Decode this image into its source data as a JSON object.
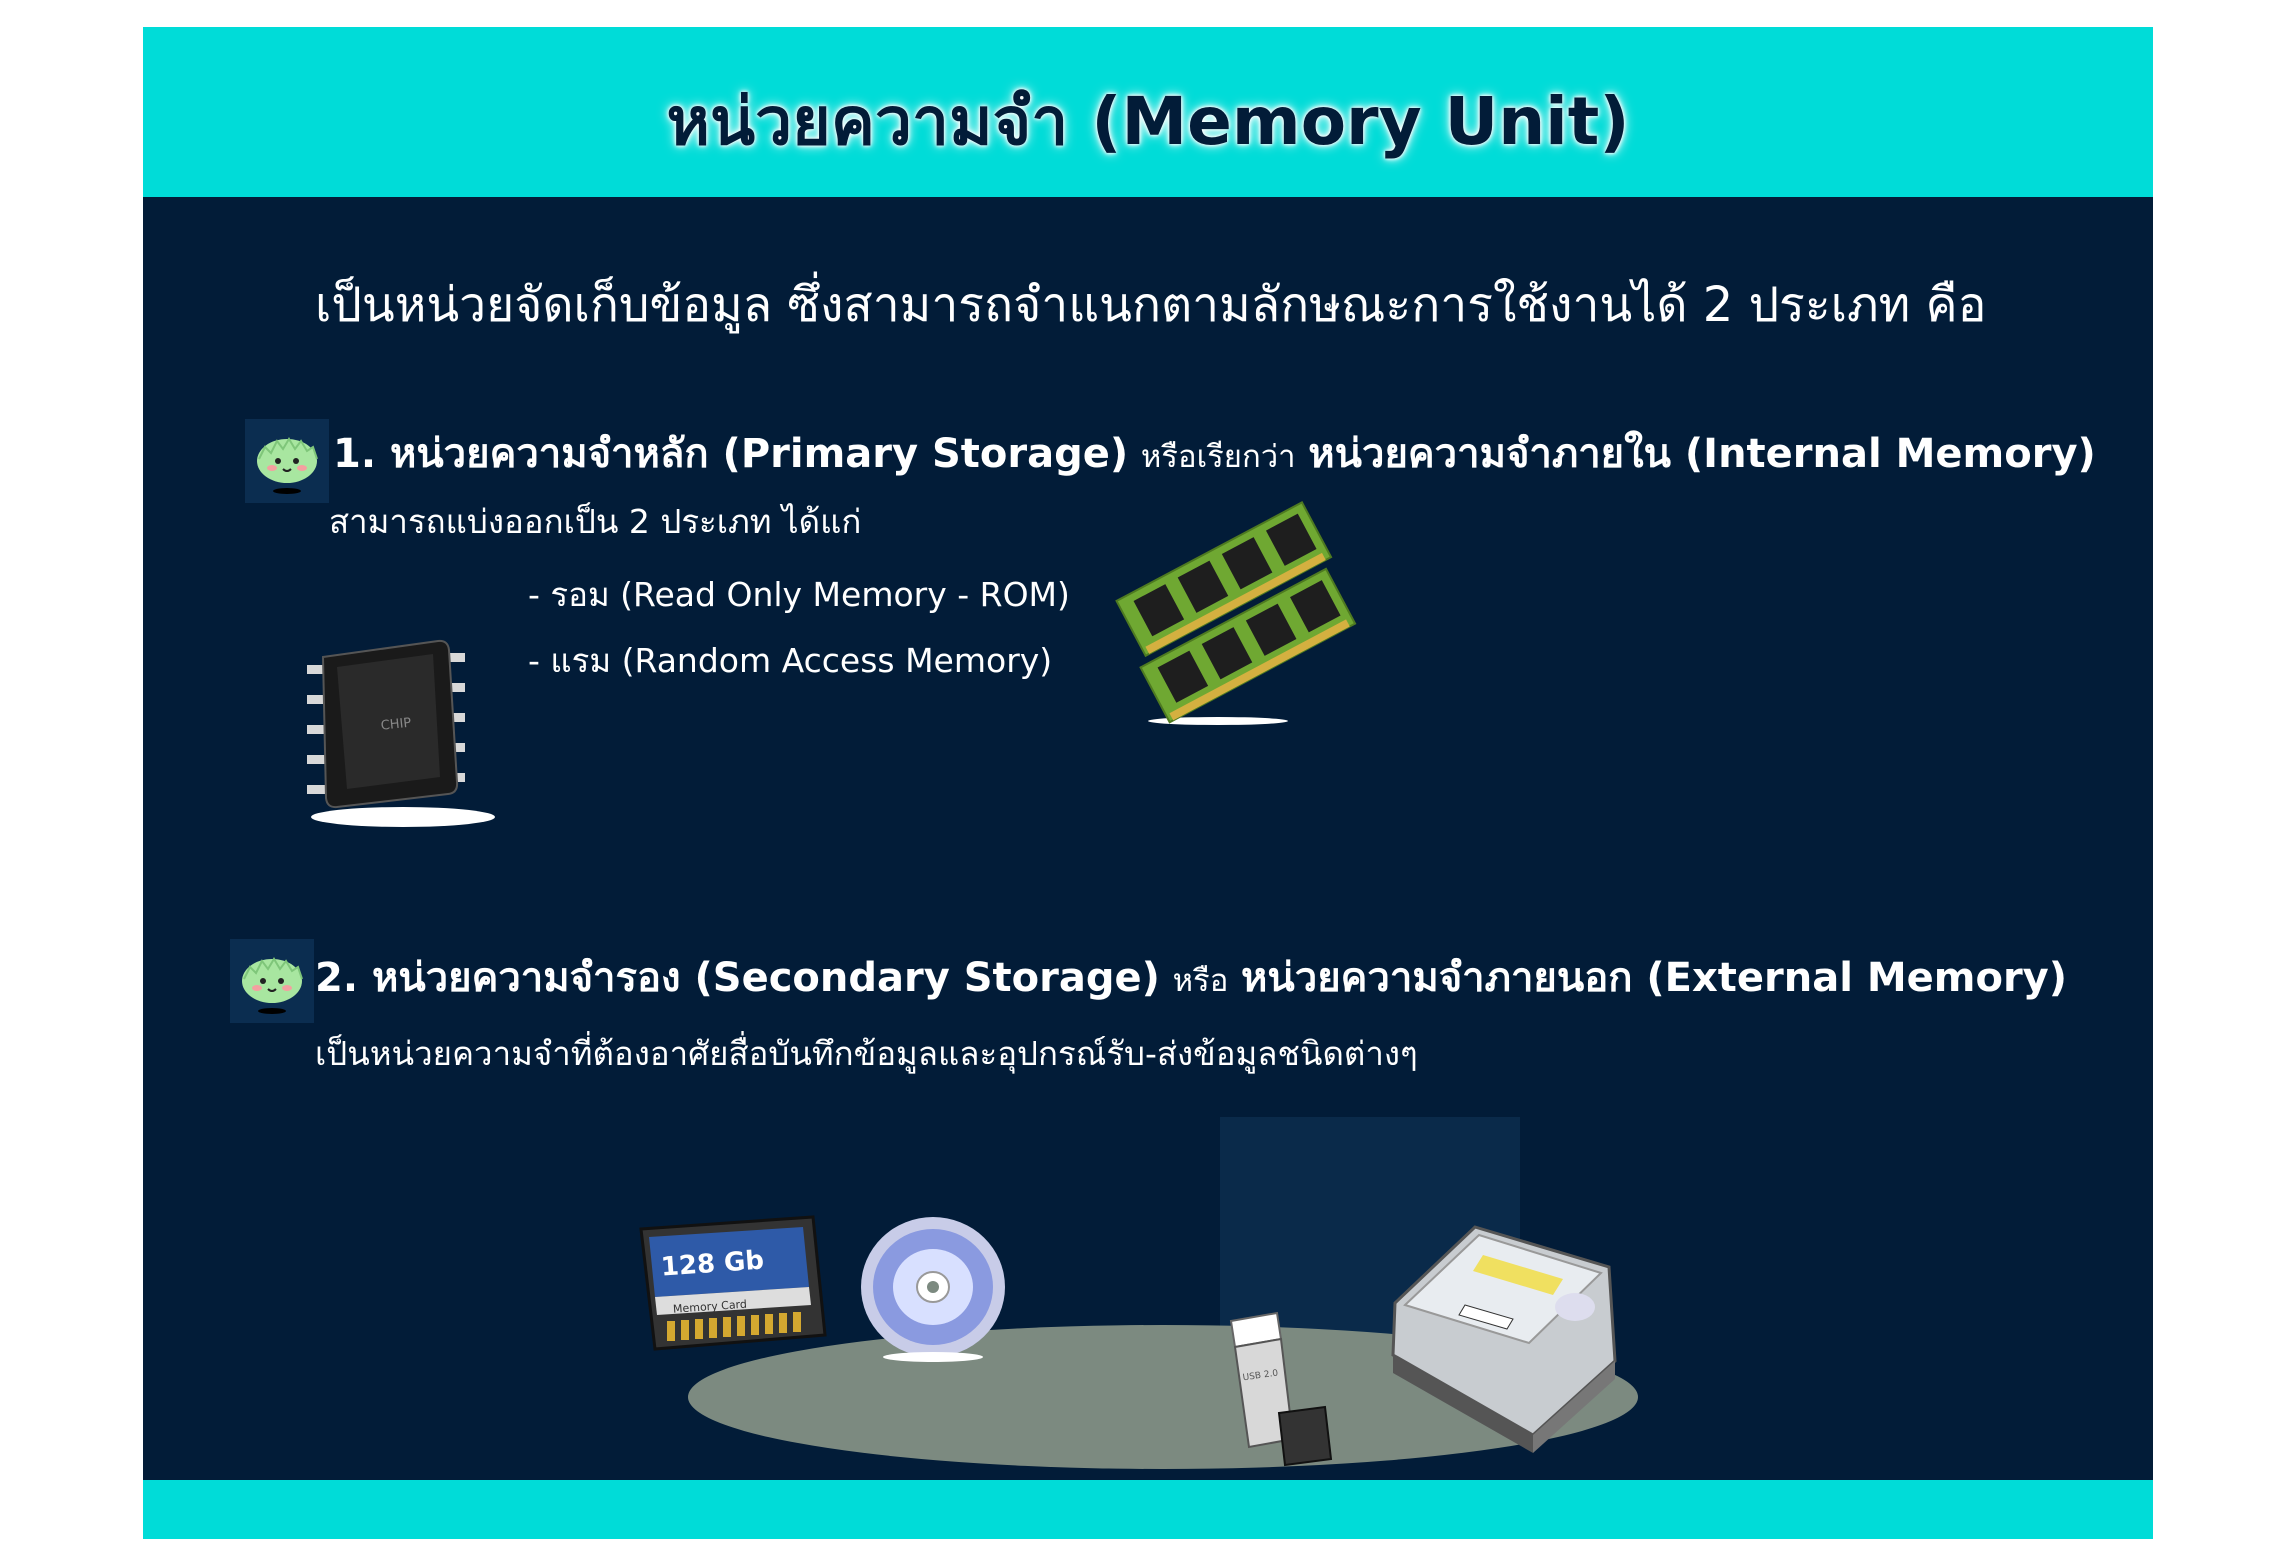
{
  "title": "หน่วยความจำ (Memory Unit)",
  "intro": "เป็นหน่วยจัดเก็บข้อมูล ซึ่งสามารถจำแนกตามลักษณะการใช้งานได้ 2 ประเภท คือ",
  "section1": {
    "heading_main": "1. หน่วยความจำหลัก (Primary Storage)",
    "heading_connector": "หรือเรียกว่า",
    "heading_alt": "หน่วยความจำภายใน (Internal Memory)",
    "description": "สามารถแบ่งออกเป็น 2 ประเภท ได้แก่",
    "items": [
      "- รอม (Read Only Memory - ROM)",
      "- แรม (Random Access Memory)"
    ],
    "chip_label": "CHIP"
  },
  "section2": {
    "heading_main": "2. หน่วยความจำรอง (Secondary Storage)",
    "heading_connector": "หรือ",
    "heading_alt": "หน่วยความจำภายนอก (External Memory)",
    "description": "เป็นหน่วยความจำที่ต้องอาศัยสื่อบันทึกข้อมูลและอุปกรณ์รับ-ส่งข้อมูลชนิดต่างๆ",
    "memory_card_capacity": "128 Gb",
    "memory_card_label": "Memory Card",
    "usb_label": "USB 2.0"
  },
  "colors": {
    "accent": "#00dcd8",
    "background": "#021c38",
    "text": "#ffffff"
  }
}
